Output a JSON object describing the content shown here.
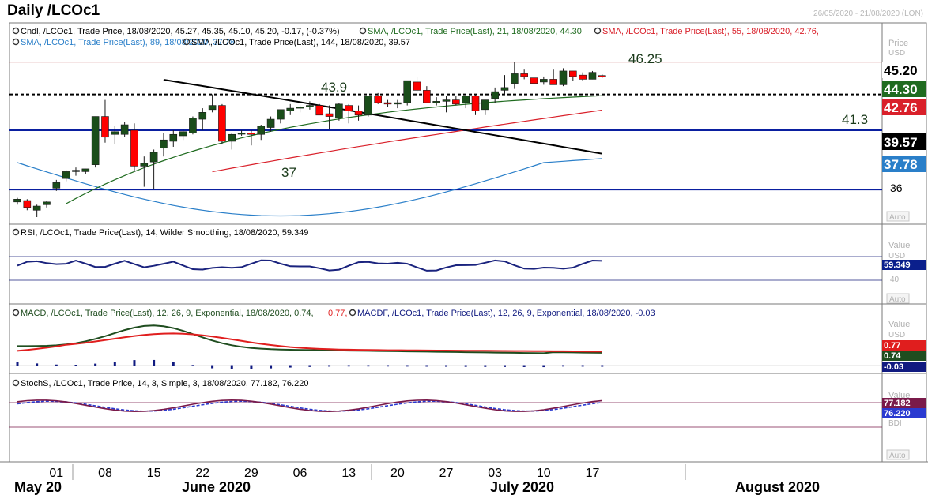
{
  "title": "Daily /LCOc1",
  "date_range": "26/05/2020 - 21/08/2020 (LON)",
  "colors": {
    "bull": "#1a4d1a",
    "bear": "#ff0000",
    "sma21": "#1f6b1f",
    "sma55": "#d9202a",
    "sma89": "#2a7fc9",
    "sma144": "#000000",
    "support": "#0a1fa0",
    "rsi": "#1a237e",
    "macd": "#1f4d1f",
    "macd_signal": "#e01e1e",
    "macdf": "#101a80",
    "stoch_k": "#7a1a4a",
    "stoch_d": "#2a3ad0"
  },
  "price_panel": {
    "legend_line1": [
      {
        "icon": "gear-icon",
        "text": "Cndl, /LCOc1, Trade Price, 18/08/2020, 45.27, 45.35, 45.10, 45.20, -0.17, (-0.37%)",
        "color": "#000000"
      },
      {
        "icon": "gear-icon",
        "text": "SMA, /LCOc1, Trade Price(Last), 21, 18/08/2020, 44.30",
        "color": "#1f6b1f"
      },
      {
        "icon": "gear-icon",
        "text": "SMA, /LCOc1, Trade Price(Last), 55, 18/08/2020, 42.76,",
        "color": "#d9202a"
      }
    ],
    "legend_line2": [
      {
        "icon": "gear-icon",
        "text": "SMA, /LCOc1, Trade Price(Last), 89, 18/08/2020, 37.78,",
        "color": "#2a7fc9"
      },
      {
        "icon": "gear-icon",
        "text": "SMA, /LCOc1, Trade Price(Last), 144, 18/08/2020, 39.57",
        "color": "#000000"
      }
    ],
    "axis_header": "Price",
    "axis_unit": "USD",
    "tick_36": "36",
    "auto_label": "Auto",
    "level_labels": {
      "l4625": "46.25",
      "l439": "43.9",
      "l413": "41.3",
      "l37": "37"
    },
    "value_tags": {
      "last": "45.20",
      "sma21": "44.30",
      "sma55": "42.76",
      "sma144": "39.57",
      "sma89": "37.78"
    }
  },
  "rsi_panel": {
    "legend": "RSI, /LCOc1, Trade Price(Last), 14, Wilder Smoothing, 18/08/2020, 59.349",
    "axis_header": "Value",
    "axis_unit": "USD",
    "tick_40": "40",
    "value_tag": "59.349",
    "auto_label": "Auto"
  },
  "macd_panel": {
    "legend_macd": "MACD, /LCOc1, Trade Price(Last), 12, 26, 9, Exponential, 18/08/2020, 0.74,",
    "legend_signal": "0.77,",
    "legend_macdf": "MACDF, /LCOc1, Trade Price(Last), 12, 26, 9, Exponential, 18/08/2020, -0.03",
    "axis_header": "Value",
    "axis_unit": "USD",
    "tags": {
      "signal": "0.77",
      "macd": "0.74",
      "hist": "-0.03"
    },
    "auto_label": "Auto"
  },
  "stoch_panel": {
    "legend": "StochS, /LCOc1, Trade Price, 14, 3, Simple, 3, 18/08/2020, 77.182, 76.220",
    "axis_header": "Value",
    "axis_unit": "BDI",
    "tags": {
      "k": "77.182",
      "d": "76.220"
    },
    "auto_label": "Auto"
  },
  "x_axis": {
    "day_ticks": [
      "01",
      "08",
      "15",
      "22",
      "29",
      "06",
      "13",
      "20",
      "27",
      "03",
      "10",
      "17"
    ],
    "months": [
      "May 20",
      "June 2020",
      "July 2020",
      "August 2020"
    ]
  },
  "chart_data": {
    "type": "candlestick",
    "title": "Daily /LCOc1",
    "ylabel": "Price USD",
    "ylim": [
      34.6,
      47.2
    ],
    "dates": [
      "2020-05-26",
      "2020-05-27",
      "2020-05-28",
      "2020-05-29",
      "2020-06-01",
      "2020-06-02",
      "2020-06-03",
      "2020-06-04",
      "2020-06-05",
      "2020-06-08",
      "2020-06-09",
      "2020-06-10",
      "2020-06-11",
      "2020-06-12",
      "2020-06-15",
      "2020-06-16",
      "2020-06-17",
      "2020-06-18",
      "2020-06-19",
      "2020-06-22",
      "2020-06-23",
      "2020-06-24",
      "2020-06-25",
      "2020-06-26",
      "2020-06-29",
      "2020-06-30",
      "2020-07-01",
      "2020-07-02",
      "2020-07-03",
      "2020-07-06",
      "2020-07-07",
      "2020-07-08",
      "2020-07-09",
      "2020-07-10",
      "2020-07-13",
      "2020-07-14",
      "2020-07-15",
      "2020-07-16",
      "2020-07-17",
      "2020-07-20",
      "2020-07-21",
      "2020-07-22",
      "2020-07-23",
      "2020-07-24",
      "2020-07-27",
      "2020-07-28",
      "2020-07-29",
      "2020-07-30",
      "2020-07-31",
      "2020-08-03",
      "2020-08-04",
      "2020-08-05",
      "2020-08-06",
      "2020-08-07",
      "2020-08-10",
      "2020-08-11",
      "2020-08-12",
      "2020-08-13",
      "2020-08-14",
      "2020-08-17",
      "2020-08-18"
    ],
    "ohlc": [
      [
        36.1,
        36.4,
        35.9,
        36.3
      ],
      [
        36.2,
        36.3,
        35.5,
        35.7
      ],
      [
        35.5,
        35.9,
        35.0,
        35.8
      ],
      [
        35.9,
        36.2,
        35.7,
        36.1
      ],
      [
        37.1,
        37.7,
        36.9,
        37.5
      ],
      [
        37.8,
        38.4,
        37.6,
        38.3
      ],
      [
        38.3,
        38.6,
        38.0,
        38.4
      ],
      [
        38.3,
        38.5,
        38.1,
        38.5
      ],
      [
        38.8,
        42.3,
        38.6,
        42.3
      ],
      [
        42.3,
        43.5,
        40.4,
        40.8
      ],
      [
        41.0,
        41.6,
        40.3,
        41.2
      ],
      [
        41.0,
        41.9,
        40.8,
        41.7
      ],
      [
        41.3,
        41.8,
        38.3,
        38.7
      ],
      [
        38.7,
        39.4,
        37.2,
        38.9
      ],
      [
        39.0,
        39.9,
        37.0,
        39.7
      ],
      [
        40.0,
        41.1,
        39.4,
        40.6
      ],
      [
        40.5,
        41.3,
        40.1,
        41.0
      ],
      [
        40.9,
        41.4,
        40.6,
        41.2
      ],
      [
        41.1,
        42.3,
        41.0,
        42.2
      ],
      [
        42.1,
        42.9,
        41.3,
        42.6
      ],
      [
        42.8,
        43.9,
        42.6,
        43.1
      ],
      [
        43.1,
        43.2,
        40.3,
        40.5
      ],
      [
        40.5,
        41.1,
        39.9,
        41.0
      ],
      [
        41.1,
        41.3,
        40.9,
        41.1
      ],
      [
        41.1,
        41.3,
        40.2,
        41.0
      ],
      [
        41.0,
        41.7,
        40.6,
        41.6
      ],
      [
        41.5,
        42.3,
        41.2,
        42.1
      ],
      [
        42.1,
        42.8,
        41.8,
        42.8
      ],
      [
        42.7,
        43.2,
        42.4,
        42.9
      ],
      [
        42.9,
        43.1,
        42.6,
        43.0
      ],
      [
        43.0,
        43.4,
        42.8,
        43.1
      ],
      [
        43.1,
        43.2,
        42.4,
        42.4
      ],
      [
        42.5,
        43.1,
        41.4,
        42.3
      ],
      [
        42.2,
        43.3,
        42.0,
        43.2
      ],
      [
        43.1,
        43.2,
        41.8,
        42.7
      ],
      [
        42.7,
        43.1,
        42.0,
        42.4
      ],
      [
        42.4,
        43.8,
        42.3,
        43.8
      ],
      [
        43.8,
        44.0,
        43.2,
        43.3
      ],
      [
        43.3,
        43.5,
        43.0,
        43.2
      ],
      [
        43.2,
        43.5,
        42.9,
        43.3
      ],
      [
        43.3,
        44.9,
        43.1,
        44.9
      ],
      [
        44.8,
        45.2,
        44.1,
        44.2
      ],
      [
        44.2,
        44.5,
        43.4,
        43.3
      ],
      [
        43.3,
        43.7,
        43.1,
        43.4
      ],
      [
        43.4,
        43.8,
        42.6,
        43.5
      ],
      [
        43.5,
        43.8,
        43.1,
        43.2
      ],
      [
        43.3,
        43.8,
        42.9,
        43.8
      ],
      [
        43.8,
        43.9,
        42.4,
        42.7
      ],
      [
        42.8,
        43.5,
        42.4,
        43.5
      ],
      [
        43.6,
        44.4,
        43.3,
        44.1
      ],
      [
        44.2,
        45.3,
        43.9,
        44.4
      ],
      [
        44.7,
        46.25,
        44.3,
        45.4
      ],
      [
        45.4,
        45.7,
        45.0,
        45.2
      ],
      [
        45.1,
        45.2,
        44.3,
        44.7
      ],
      [
        44.8,
        45.2,
        44.6,
        45.0
      ],
      [
        45.0,
        45.7,
        44.7,
        44.6
      ],
      [
        44.6,
        45.8,
        44.5,
        45.6
      ],
      [
        45.6,
        45.6,
        44.9,
        45.2
      ],
      [
        45.3,
        45.5,
        44.9,
        45.0
      ],
      [
        45.0,
        45.6,
        45.0,
        45.5
      ],
      [
        45.27,
        45.35,
        45.1,
        45.2
      ]
    ],
    "horizontal_levels": [
      {
        "label": "46.25",
        "value": 46.25,
        "style": "solid"
      },
      {
        "label": "43.9",
        "value": 43.9,
        "style": "dashed"
      },
      {
        "label": "41.3",
        "value": 41.3,
        "style": "solid"
      },
      {
        "label": "37",
        "value": 37.0,
        "style": "solid"
      }
    ],
    "series": [
      {
        "name": "SMA 21",
        "last": 44.3
      },
      {
        "name": "SMA 55",
        "last": 42.76
      },
      {
        "name": "SMA 89",
        "last": 37.78
      },
      {
        "name": "SMA 144",
        "last": 39.57
      }
    ],
    "indicators": {
      "rsi_last": 59.349,
      "macd_last": 0.74,
      "macd_signal_last": 0.77,
      "macdf_last": -0.03,
      "stoch_k_last": 77.182,
      "stoch_d_last": 76.22
    },
    "x_tick_labels": [
      "01",
      "08",
      "15",
      "22",
      "29",
      "06",
      "13",
      "20",
      "27",
      "03",
      "10",
      "17"
    ],
    "month_labels": [
      "May 20",
      "June 2020",
      "July 2020",
      "August 2020"
    ]
  }
}
